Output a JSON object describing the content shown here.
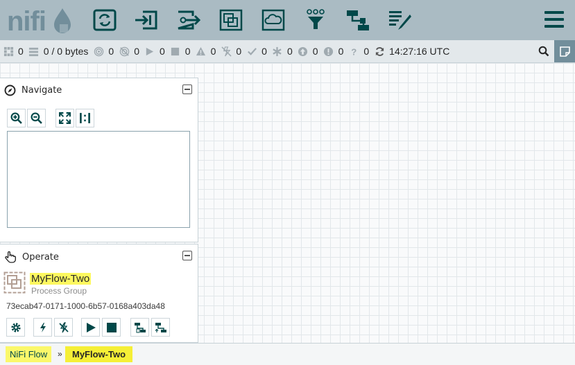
{
  "app": {
    "logo_text": "nifi"
  },
  "toolbar": {
    "items": [
      "processor-icon",
      "input-port-icon",
      "output-port-icon",
      "process-group-icon",
      "remote-process-group-icon",
      "funnel-icon",
      "template-icon",
      "label-icon"
    ],
    "menu_icon": "hamburger-icon",
    "accent_color": "#004849",
    "background_color": "#aabbc3"
  },
  "status": {
    "active_threads": "0",
    "queued": "0 / 0 bytes",
    "transmitting": "0",
    "not_transmitting": "0",
    "running": "0",
    "stopped": "0",
    "invalid": "0",
    "disabled": "0",
    "up_to_date": "0",
    "locally_modified": "0",
    "stale": "0",
    "locally_modified_and_stale": "0",
    "sync_failure": "0",
    "last_refreshed": "14:27:16 UTC"
  },
  "navigate": {
    "title": "Navigate"
  },
  "operate": {
    "title": "Operate",
    "component_name": "MyFlow-Two",
    "component_type": "Process Group",
    "component_id": "73ecab47-0171-1000-6b57-0168a403da48"
  },
  "breadcrumbs": {
    "root": "NiFi Flow",
    "separator": "»",
    "current": "MyFlow-Two"
  }
}
